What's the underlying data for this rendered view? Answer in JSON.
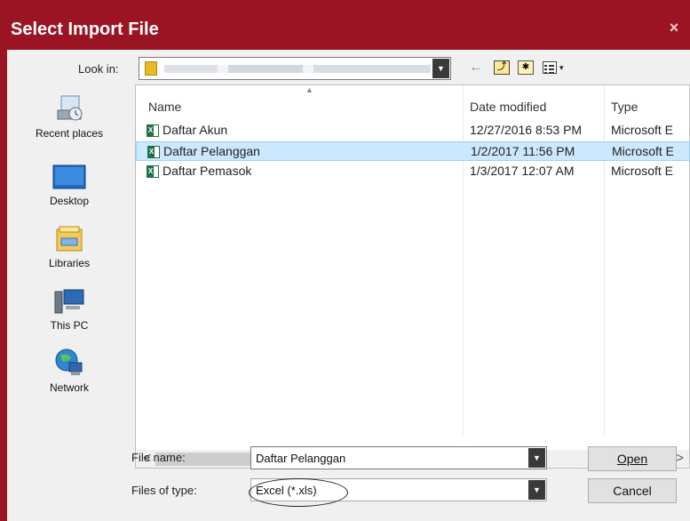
{
  "dialog": {
    "title": "Select Import File",
    "close_glyph": "×"
  },
  "lookin": {
    "label": "Look in:"
  },
  "toolbar": {
    "back_glyph": "←",
    "up_glyph": "⤴",
    "new_folder_glyph": "✱",
    "view_arrow": "▾"
  },
  "places": [
    {
      "label": "Recent places",
      "icon": "recent-places-icon"
    },
    {
      "label": "Desktop",
      "icon": "desktop-icon"
    },
    {
      "label": "Libraries",
      "icon": "libraries-icon"
    },
    {
      "label": "This PC",
      "icon": "this-pc-icon"
    },
    {
      "label": "Network",
      "icon": "network-icon"
    }
  ],
  "columns": {
    "name": "Name",
    "date": "Date modified",
    "type": "Type"
  },
  "files": [
    {
      "name": "Daftar Akun",
      "date": "12/27/2016 8:53 PM",
      "type": "Microsoft E"
    },
    {
      "name": "Daftar Pelanggan",
      "date": "1/2/2017 11:56 PM",
      "type": "Microsoft E",
      "selected": true
    },
    {
      "name": "Daftar Pemasok",
      "date": "1/3/2017 12:07 AM",
      "type": "Microsoft E"
    }
  ],
  "scroll": {
    "left_glyph": "<",
    "right_glyph": ">"
  },
  "filename": {
    "label": "File name:",
    "value": "Daftar Pelanggan"
  },
  "filetype": {
    "label": "Files of type:",
    "value": "Excel (*.xls)"
  },
  "buttons": {
    "open": "Open",
    "cancel": "Cancel"
  },
  "colors": {
    "title_bar": "#9b1424",
    "selection": "#cce8ff",
    "excel_green": "#1e7145"
  }
}
